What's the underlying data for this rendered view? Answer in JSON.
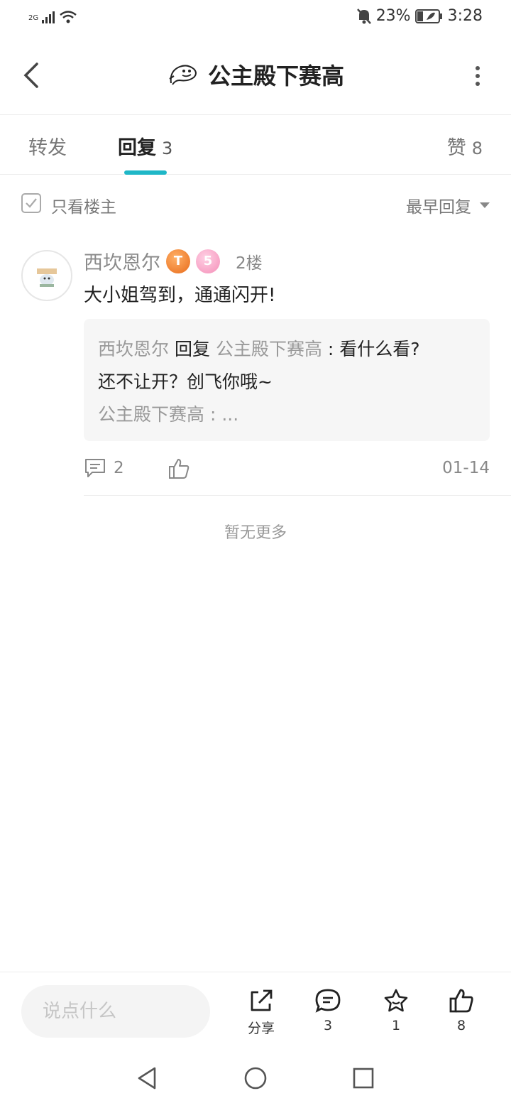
{
  "status_bar": {
    "network": "2G",
    "battery": "23%",
    "time": "3:28"
  },
  "header": {
    "title": "公主殿下赛高"
  },
  "tabs": [
    {
      "label": "转发"
    },
    {
      "label": "回复",
      "count": "3"
    },
    {
      "label": "赞",
      "count": "8"
    }
  ],
  "filter": {
    "only_op_label": "只看楼主",
    "sort_label": "最早回复"
  },
  "post": {
    "author": "西坎恩尔",
    "badge_t": "T",
    "badge_level": "5",
    "floor": "2楼",
    "body": "大小姐驾到，通通闪开!",
    "quote": {
      "replier": "西坎恩尔",
      "reply_word": "回复",
      "target": "公主殿下赛高",
      "text_a": " : 看什么看?",
      "text_b": "还不让开？创飞你哦~",
      "second_author": "公主殿下赛高",
      "second_text": " : ..."
    },
    "comment_count": "2",
    "date": "01-14"
  },
  "no_more": "暂无更多",
  "bottom_bar": {
    "input_placeholder": "说点什么",
    "share_label": "分享",
    "comment_count": "3",
    "star_count": "1",
    "like_count": "8"
  }
}
